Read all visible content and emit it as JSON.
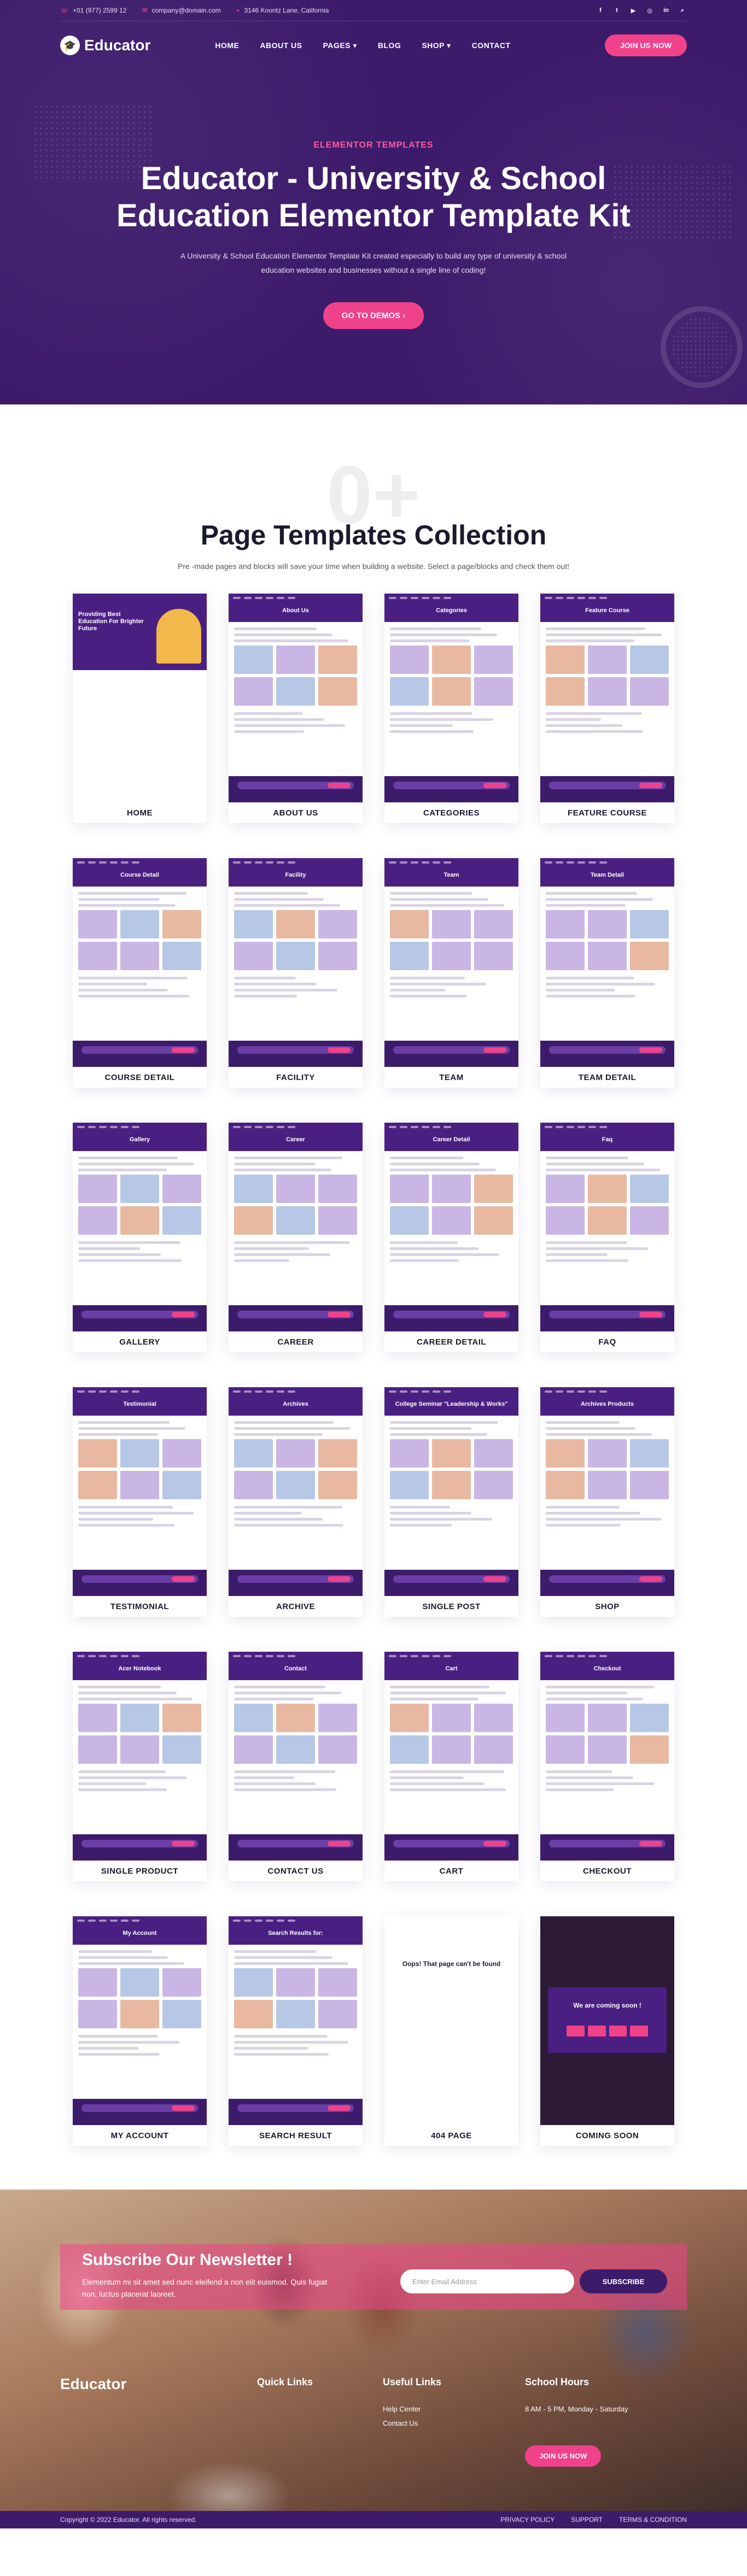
{
  "topbar": {
    "phone": "+01 (977) 2599 12",
    "email": "company@domain.com",
    "address": "3146 Koontz Lane, California",
    "social": [
      {
        "icon": "facebook-icon",
        "glyph": "f"
      },
      {
        "icon": "twitter-icon",
        "glyph": "t"
      },
      {
        "icon": "youtube-icon",
        "glyph": "▶"
      },
      {
        "icon": "instagram-icon",
        "glyph": "◎"
      },
      {
        "icon": "linkedin-icon",
        "glyph": "in"
      },
      {
        "icon": "search-icon",
        "glyph": "⌕"
      }
    ]
  },
  "nav": {
    "brand": "Educator",
    "items": [
      "HOME",
      "ABOUT US",
      "PAGES ▾",
      "BLOG",
      "SHOP ▾",
      "CONTACT"
    ],
    "join": "JOIN US NOW"
  },
  "hero": {
    "eyebrow": "ELEMENTOR TEMPLATES",
    "title": "Educator - University & School Education Elementor Template Kit",
    "description": "A University & School Education Elementor Template Kit created especially to build any type of university & school education websites and businesses without a single line of coding!",
    "cta": "GO TO DEMOS ›"
  },
  "templates": {
    "ghost": "0+",
    "title": "Page Templates Collection",
    "description": "Pre -made pages and blocks will save your time when building a website. Select a page/blocks and check them out!",
    "cards": [
      {
        "label": "HOME",
        "heading": "Providing Best Education For Brighter Future"
      },
      {
        "label": "ABOUT US",
        "heading": "About Us"
      },
      {
        "label": "CATEGORIES",
        "heading": "Categories"
      },
      {
        "label": "FEATURE COURSE",
        "heading": "Feature Course"
      },
      {
        "label": "COURSE DETAIL",
        "heading": "Course Detail"
      },
      {
        "label": "FACILITY",
        "heading": "Facility"
      },
      {
        "label": "TEAM",
        "heading": "Team"
      },
      {
        "label": "TEAM DETAIL",
        "heading": "Team Detail"
      },
      {
        "label": "GALLERY",
        "heading": "Gallery"
      },
      {
        "label": "CAREER",
        "heading": "Career"
      },
      {
        "label": "CAREER DETAIL",
        "heading": "Career Detail"
      },
      {
        "label": "FAQ",
        "heading": "Faq"
      },
      {
        "label": "TESTIMONIAL",
        "heading": "Testimonial"
      },
      {
        "label": "ARCHIVE",
        "heading": "Archives"
      },
      {
        "label": "SINGLE POST",
        "heading": "College Seminar \"Leadership & Works\""
      },
      {
        "label": "SHOP",
        "heading": "Archives Products"
      },
      {
        "label": "SINGLE PRODUCT",
        "heading": "Acer Notebook"
      },
      {
        "label": "CONTACT US",
        "heading": "Contact"
      },
      {
        "label": "CART",
        "heading": "Cart"
      },
      {
        "label": "CHECKOUT",
        "heading": "Checkout"
      },
      {
        "label": "MY ACCOUNT",
        "heading": "My Account"
      },
      {
        "label": "SEARCH RESULT",
        "heading": "Search Results for:"
      },
      {
        "label": "404 PAGE",
        "heading": "Oops! That page can't be found"
      },
      {
        "label": "COMING SOON",
        "heading": "We are coming soon !"
      }
    ]
  },
  "newsletter": {
    "title": "Subscribe Our Newsletter !",
    "description": "Elementum mi sit amet sed nunc eleifend a non elit euismod. Quis fugiat non, luctus placerat laoreet.",
    "placeholder": "Enter Email Address",
    "button": "SUBSCRIBE"
  },
  "footer": {
    "brand": "Educator",
    "quick_links": "Quick Links",
    "useful_links": "Useful Links",
    "useful_items": [
      "Help Center",
      "Contact Us"
    ],
    "school_hours": "School Hours",
    "hours": "8 AM - 5 PM, Monday - Saturday",
    "join": "JOIN US NOW",
    "copyright": "Copyright © 2022 Educator. All rights reserved.",
    "links": [
      "PRIVACY POLICY",
      "SUPPORT",
      "TERMS & CONDITION"
    ]
  }
}
